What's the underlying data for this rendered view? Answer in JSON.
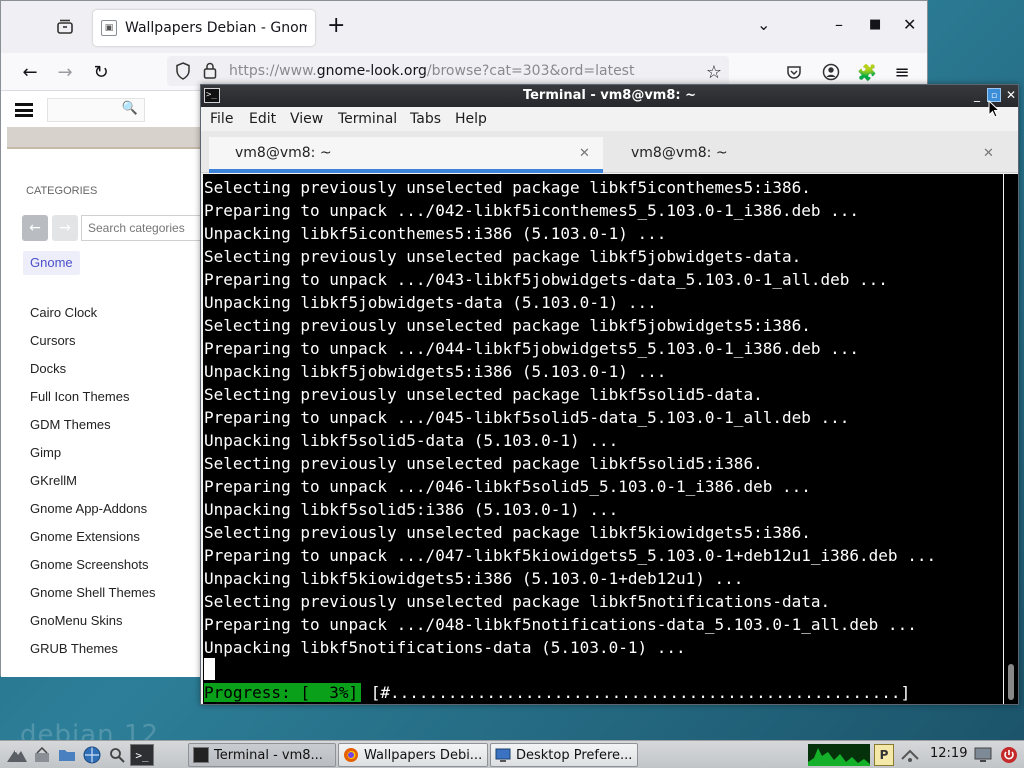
{
  "browser": {
    "tab_title": "Wallpapers Debian - Gnome",
    "new_tab": "+",
    "url_prefix": "https://www.",
    "url_domain": "gnome-look.org",
    "url_rest": "/browse?cat=303&ord=latest",
    "controls": {
      "list": "⌄",
      "minimize": "–",
      "maximize": "□",
      "close": "✕"
    }
  },
  "page": {
    "categories_heading": "CATEGORIES",
    "search_placeholder": "Search categories",
    "active_category": "Gnome",
    "categories": [
      "Cairo Clock",
      "Cursors",
      "Docks",
      "Full Icon Themes",
      "GDM Themes",
      "Gimp",
      "GKrellM",
      "Gnome App-Addons",
      "Gnome Extensions",
      "Gnome Screenshots",
      "Gnome Shell Themes",
      "GnoMenu Skins",
      "GRUB Themes"
    ]
  },
  "terminal": {
    "title": "Terminal - vm8@vm8: ~",
    "menu": [
      "File",
      "Edit",
      "View",
      "Terminal",
      "Tabs",
      "Help"
    ],
    "tabs": [
      {
        "label": "vm8@vm8: ~",
        "active": true
      },
      {
        "label": "vm8@vm8: ~",
        "active": false
      }
    ],
    "lines": [
      "Selecting previously unselected package libkf5iconthemes5:i386.",
      "Preparing to unpack .../042-libkf5iconthemes5_5.103.0-1_i386.deb ...",
      "Unpacking libkf5iconthemes5:i386 (5.103.0-1) ...",
      "Selecting previously unselected package libkf5jobwidgets-data.",
      "Preparing to unpack .../043-libkf5jobwidgets-data_5.103.0-1_all.deb ...",
      "Unpacking libkf5jobwidgets-data (5.103.0-1) ...",
      "Selecting previously unselected package libkf5jobwidgets5:i386.",
      "Preparing to unpack .../044-libkf5jobwidgets5_5.103.0-1_i386.deb ...",
      "Unpacking libkf5jobwidgets5:i386 (5.103.0-1) ...",
      "Selecting previously unselected package libkf5solid5-data.",
      "Preparing to unpack .../045-libkf5solid5-data_5.103.0-1_all.deb ...",
      "Unpacking libkf5solid5-data (5.103.0-1) ...",
      "Selecting previously unselected package libkf5solid5:i386.",
      "Preparing to unpack .../046-libkf5solid5_5.103.0-1_i386.deb ...",
      "Unpacking libkf5solid5:i386 (5.103.0-1) ...",
      "Selecting previously unselected package libkf5kiowidgets5:i386.",
      "Preparing to unpack .../047-libkf5kiowidgets5_5.103.0-1+deb12u1_i386.deb ...",
      "Unpacking libkf5kiowidgets5:i386 (5.103.0-1+deb12u1) ...",
      "Selecting previously unselected package libkf5notifications-data.",
      "Preparing to unpack .../048-libkf5notifications-data_5.103.0-1_all.deb ...",
      "Unpacking libkf5notifications-data (5.103.0-1) ..."
    ],
    "progress_label": "Progress: [  3%]",
    "progress_bar": " [#.....................................................]"
  },
  "taskbar": {
    "tasks": [
      {
        "label": "Terminal - vm8...",
        "icon": "terminal-icon"
      },
      {
        "label": "Wallpapers Debi...",
        "icon": "firefox-icon"
      },
      {
        "label": "Desktop Prefere...",
        "icon": "desktop-preferences-icon"
      }
    ],
    "clock": "12:19"
  },
  "desktop": {
    "watermark": "debian 12"
  },
  "colors": {
    "progress_green": "#0aa019",
    "terminal_bg": "#000000",
    "tab_accent": "#3b84d9"
  }
}
